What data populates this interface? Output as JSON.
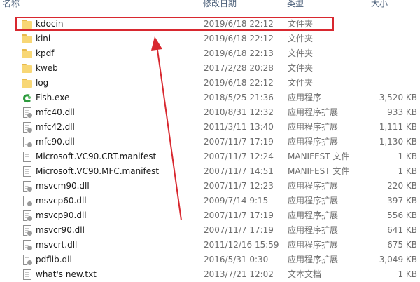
{
  "columns": {
    "name": "名称",
    "date": "修改日期",
    "type": "类型",
    "size": "大小"
  },
  "files": [
    {
      "name": "kdocin",
      "date": "2019/6/18 22:12",
      "type": "文件夹",
      "size": "",
      "icon": "folder-icon"
    },
    {
      "name": "kini",
      "date": "2019/6/18 22:12",
      "type": "文件夹",
      "size": "",
      "icon": "folder-icon"
    },
    {
      "name": "kpdf",
      "date": "2019/6/18 22:13",
      "type": "文件夹",
      "size": "",
      "icon": "folder-icon"
    },
    {
      "name": "kweb",
      "date": "2017/2/28 20:28",
      "type": "文件夹",
      "size": "",
      "icon": "folder-icon"
    },
    {
      "name": "log",
      "date": "2019/6/18 22:12",
      "type": "文件夹",
      "size": "",
      "icon": "folder-icon"
    },
    {
      "name": "Fish.exe",
      "date": "2018/5/25 21:36",
      "type": "应用程序",
      "size": "3,520 KB",
      "icon": "exe-icon"
    },
    {
      "name": "mfc40.dll",
      "date": "2010/8/31 12:32",
      "type": "应用程序扩展",
      "size": "933 KB",
      "icon": "dll-icon"
    },
    {
      "name": "mfc42.dll",
      "date": "2011/3/11 13:40",
      "type": "应用程序扩展",
      "size": "1,111 KB",
      "icon": "dll-icon"
    },
    {
      "name": "mfc90.dll",
      "date": "2007/11/7 17:19",
      "type": "应用程序扩展",
      "size": "1,130 KB",
      "icon": "dll-icon"
    },
    {
      "name": "Microsoft.VC90.CRT.manifest",
      "date": "2007/11/7 12:24",
      "type": "MANIFEST 文件",
      "size": "1 KB",
      "icon": "file-icon"
    },
    {
      "name": "Microsoft.VC90.MFC.manifest",
      "date": "2007/11/7 14:51",
      "type": "MANIFEST 文件",
      "size": "1 KB",
      "icon": "file-icon"
    },
    {
      "name": "msvcm90.dll",
      "date": "2007/11/7 12:23",
      "type": "应用程序扩展",
      "size": "220 KB",
      "icon": "dll-icon"
    },
    {
      "name": "msvcp60.dll",
      "date": "2009/7/14 9:15",
      "type": "应用程序扩展",
      "size": "397 KB",
      "icon": "dll-icon"
    },
    {
      "name": "msvcp90.dll",
      "date": "2007/11/7 17:19",
      "type": "应用程序扩展",
      "size": "556 KB",
      "icon": "dll-icon"
    },
    {
      "name": "msvcr90.dll",
      "date": "2007/11/7 17:19",
      "type": "应用程序扩展",
      "size": "641 KB",
      "icon": "dll-icon"
    },
    {
      "name": "msvcrt.dll",
      "date": "2011/12/16 15:59",
      "type": "应用程序扩展",
      "size": "675 KB",
      "icon": "dll-icon"
    },
    {
      "name": "pdflib.dll",
      "date": "2016/5/31 0:30",
      "type": "应用程序扩展",
      "size": "3,049 KB",
      "icon": "dll-icon"
    },
    {
      "name": "what's new.txt",
      "date": "2013/7/21 12:02",
      "type": "文本文档",
      "size": "1 KB",
      "icon": "file-icon"
    }
  ],
  "annotation": {
    "highlighted_item": "kdocin",
    "highlight_color": "#d8282f"
  }
}
